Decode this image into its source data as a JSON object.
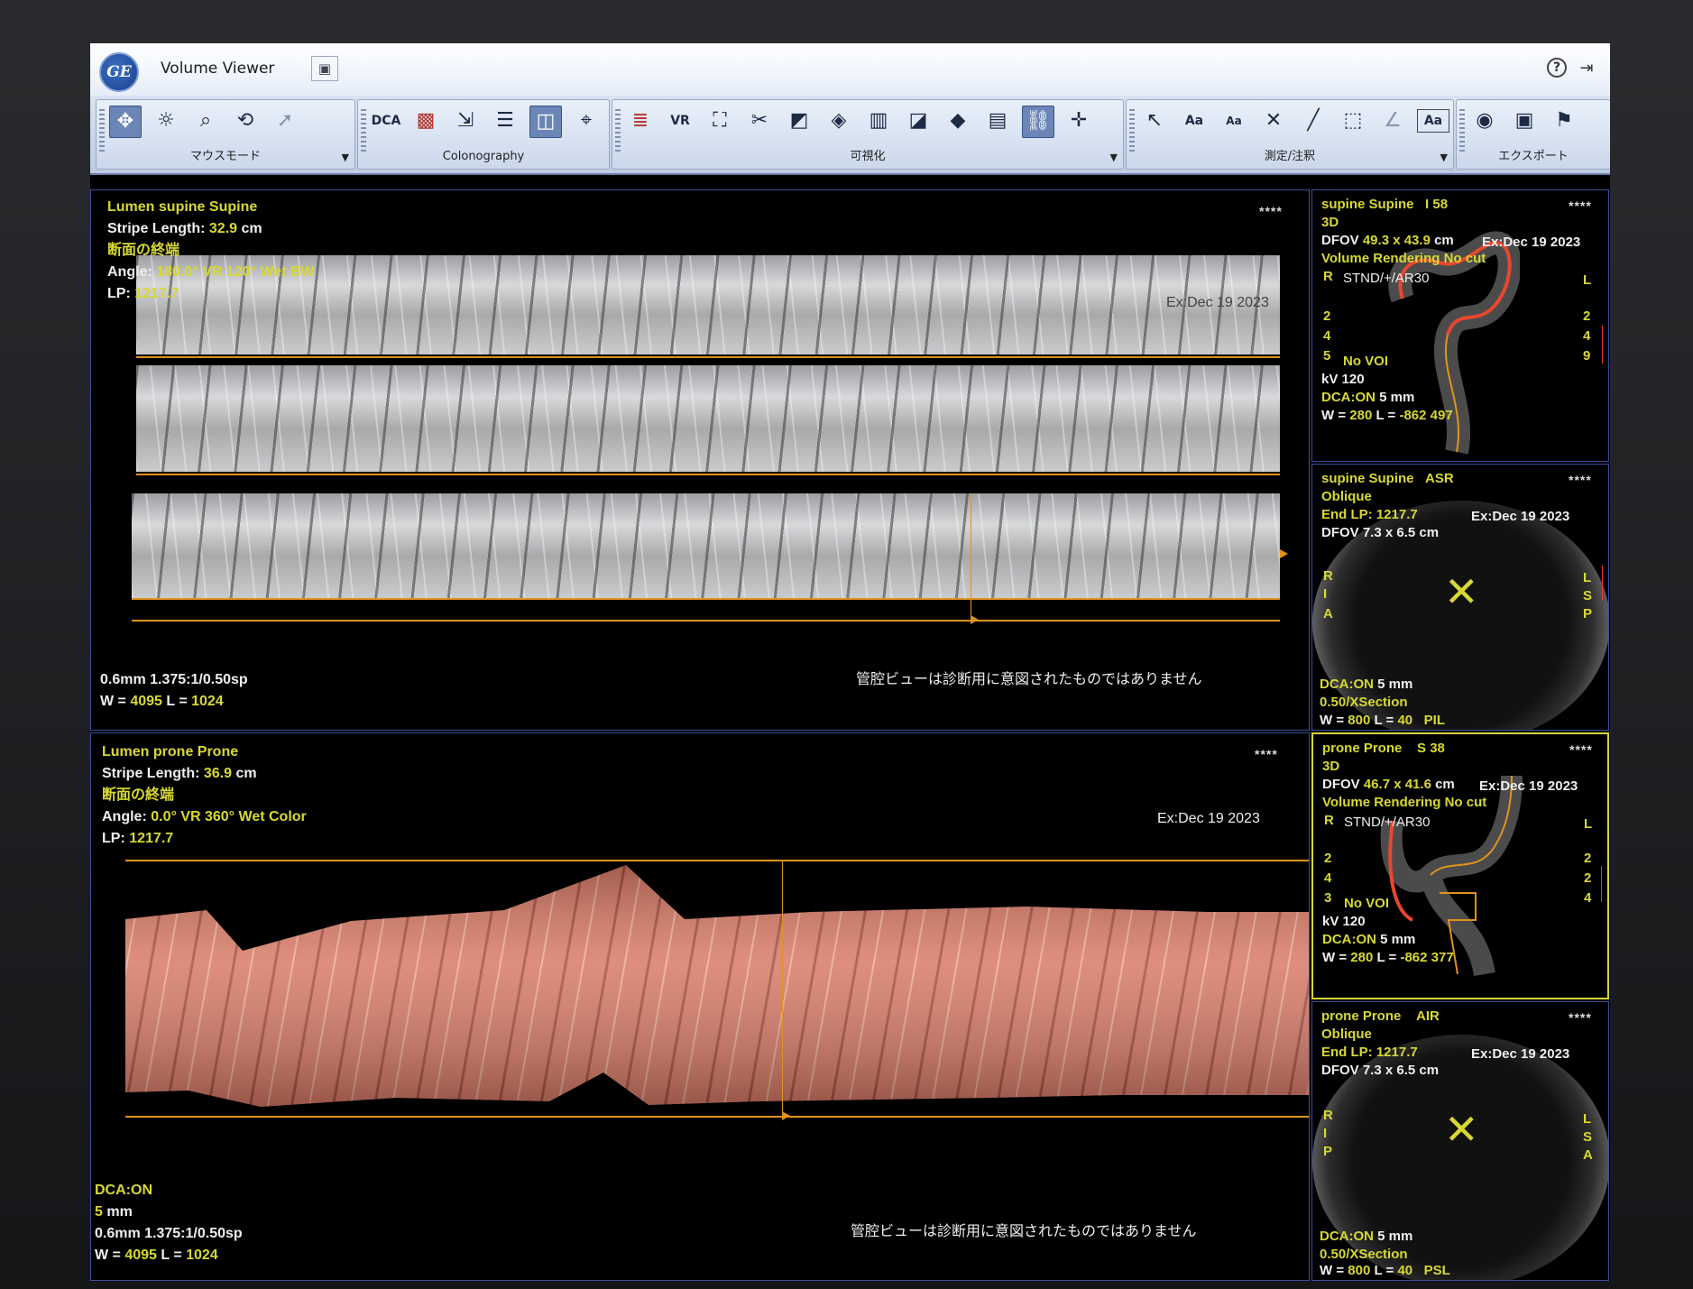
{
  "app": {
    "logo": "GE",
    "title": "Volume Viewer"
  },
  "toolbar": {
    "groups": [
      {
        "label": "マウスモード"
      },
      {
        "label": "Colonography",
        "dca": "DCA"
      },
      {
        "label": "可視化",
        "vr": "VR"
      },
      {
        "label": "測定/注釈",
        "aa1": "Aa",
        "aa2": "Aa",
        "aa3": "Aa"
      },
      {
        "label": "エクスポート"
      }
    ]
  },
  "supine_lumen": {
    "title": "Lumen supine Supine",
    "stripe_label": "Stripe Length: ",
    "stripe_value": "32.9",
    "stripe_unit": " cm",
    "section_end": "断面の終端",
    "angle_label": "Angle: ",
    "angle_value": "180.0° VR 120° Wet BW",
    "lp_label": "LP: ",
    "lp_value": "1217.7",
    "exam_date": "Ex:Dec 19 2023",
    "stars": "****",
    "params": "0.6mm 1.375:1/0.50sp",
    "w_label": "W = ",
    "w_value": "4095",
    "l_label": " L = ",
    "l_value": "1024",
    "disclaimer": "管腔ビューは診断用に意図されたものではありません"
  },
  "prone_lumen": {
    "title": "Lumen prone Prone",
    "stripe_label": "Stripe Length: ",
    "stripe_value": "36.9",
    "stripe_unit": " cm",
    "section_end": "断面の終端",
    "angle_label": "Angle: ",
    "angle_value": "0.0° VR 360° Wet Color",
    "lp_label": "LP: ",
    "lp_value": "1217.7",
    "exam_date": "Ex:Dec 19 2023",
    "stars": "****",
    "dca": "DCA:ON",
    "dca_val": "5",
    "dca_unit": " mm",
    "params": "0.6mm 1.375:1/0.50sp",
    "w_label": "W = ",
    "w_value": "4095",
    "l_label": " L = ",
    "l_value": "1024",
    "disclaimer": "管腔ビューは診断用に意図されたものではありません"
  },
  "supine_3d": {
    "title": "supine Supine",
    "slice": "I 58",
    "mode": "3D",
    "stars": "****",
    "dfov_label": "DFOV ",
    "dfov_value": "49.3 x 43.9",
    "dfov_unit": " cm",
    "exam_date": "Ex:Dec 19 2023",
    "render": "Volume Rendering No cut",
    "r": "R",
    "l": "L",
    "kernel": "STND/+/AR30",
    "left_nums": [
      "2",
      "4",
      "5"
    ],
    "right_nums": [
      "2",
      "4",
      "9"
    ],
    "voi": "No VOI",
    "kv": "kV 120",
    "dca": "DCA:ON",
    "dca_val": "5 mm",
    "w_label": "W = ",
    "w_value": "280",
    "l_label": " L = ",
    "l_value": "-862",
    "extra": "497"
  },
  "supine_oblique": {
    "title": "supine Supine",
    "plane": "ASR",
    "stars": "****",
    "mode": "Oblique",
    "end_lp": "End LP: 1217.7",
    "exam_date": "Ex:Dec 19 2023",
    "dfov": "DFOV 7.3 x 6.5 cm",
    "left_letters": [
      "R",
      "I",
      "A"
    ],
    "right_letters": [
      "L",
      "S",
      "P"
    ],
    "dca": "DCA:ON",
    "dca_val": "5",
    "dca_unit": " mm",
    "xsection": "0.50/XSection",
    "w_label": "W = ",
    "w_value": "800",
    "l_label": " L = ",
    "l_value": "40",
    "orient": "PIL"
  },
  "prone_3d": {
    "title": "prone Prone",
    "slice": "S 38",
    "mode": "3D",
    "stars": "****",
    "dfov_label": "DFOV ",
    "dfov_value": "46.7 x 41.6",
    "dfov_unit": " cm",
    "exam_date": "Ex:Dec 19 2023",
    "render": "Volume Rendering No cut",
    "r": "R",
    "l": "L",
    "kernel": "STND/+/AR30",
    "left_nums": [
      "2",
      "4",
      "3"
    ],
    "right_nums": [
      "2",
      "2",
      "4"
    ],
    "voi": "No VOI",
    "kv": "kV 120",
    "dca": "DCA:ON",
    "dca_val": "5 mm",
    "w_label": "W = ",
    "w_value": "280",
    "l_label": " L = ",
    "l_value": "-862",
    "extra": "377"
  },
  "prone_oblique": {
    "title": "prone Prone",
    "plane": "AIR",
    "stars": "****",
    "mode": "Oblique",
    "end_lp": "End LP: 1217.7",
    "exam_date": "Ex:Dec 19 2023",
    "dfov": "DFOV 7.3 x 6.5 cm",
    "left_letters": [
      "R",
      "I",
      "P"
    ],
    "right_letters": [
      "L",
      "S",
      "A"
    ],
    "dca": "DCA:ON",
    "dca_val": "5",
    "dca_unit": " mm",
    "xsection": "0.50/XSection",
    "w_label": "W = ",
    "w_value": "800",
    "l_label": " L = ",
    "l_value": "40",
    "orient": "PSL"
  },
  "colors": {
    "overlay_yellow": "#d8d833",
    "cursor_orange": "#e0921f",
    "colon_path_red": "#e8472e",
    "selected_border": "#d6d637"
  }
}
